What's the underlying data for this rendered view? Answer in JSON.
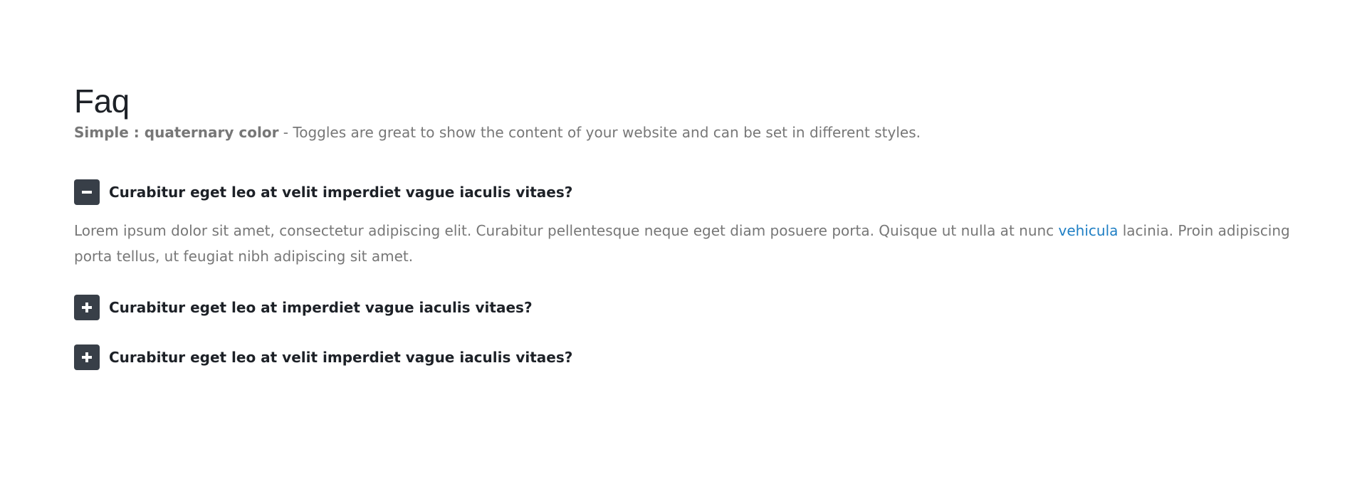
{
  "heading": {
    "title": "Faq",
    "lead_strong": "Simple : quaternary color",
    "lead_text": " - Toggles are great to show the content of your website and can be set in different styles."
  },
  "colors": {
    "toggle_icon_bg": "#383f48",
    "link": "#1f7fc4",
    "muted_text": "#777777",
    "dark_text": "#1d2127"
  },
  "toggles": [
    {
      "label": "Curabitur eget leo at velit imperdiet vague iaculis vitaes?",
      "state": "expanded",
      "icon": "minus-icon",
      "content_before_link": "Lorem ipsum dolor sit amet, consectetur adipiscing elit. Curabitur pellentesque neque eget diam posuere porta. Quisque ut nulla at nunc ",
      "content_link": "vehicula",
      "content_after_link": " lacinia. Proin adipiscing porta tellus, ut feugiat nibh adipiscing sit amet."
    },
    {
      "label": "Curabitur eget leo at imperdiet vague iaculis vitaes?",
      "state": "collapsed",
      "icon": "plus-icon"
    },
    {
      "label": "Curabitur eget leo at velit imperdiet vague iaculis vitaes?",
      "state": "collapsed",
      "icon": "plus-icon"
    }
  ]
}
